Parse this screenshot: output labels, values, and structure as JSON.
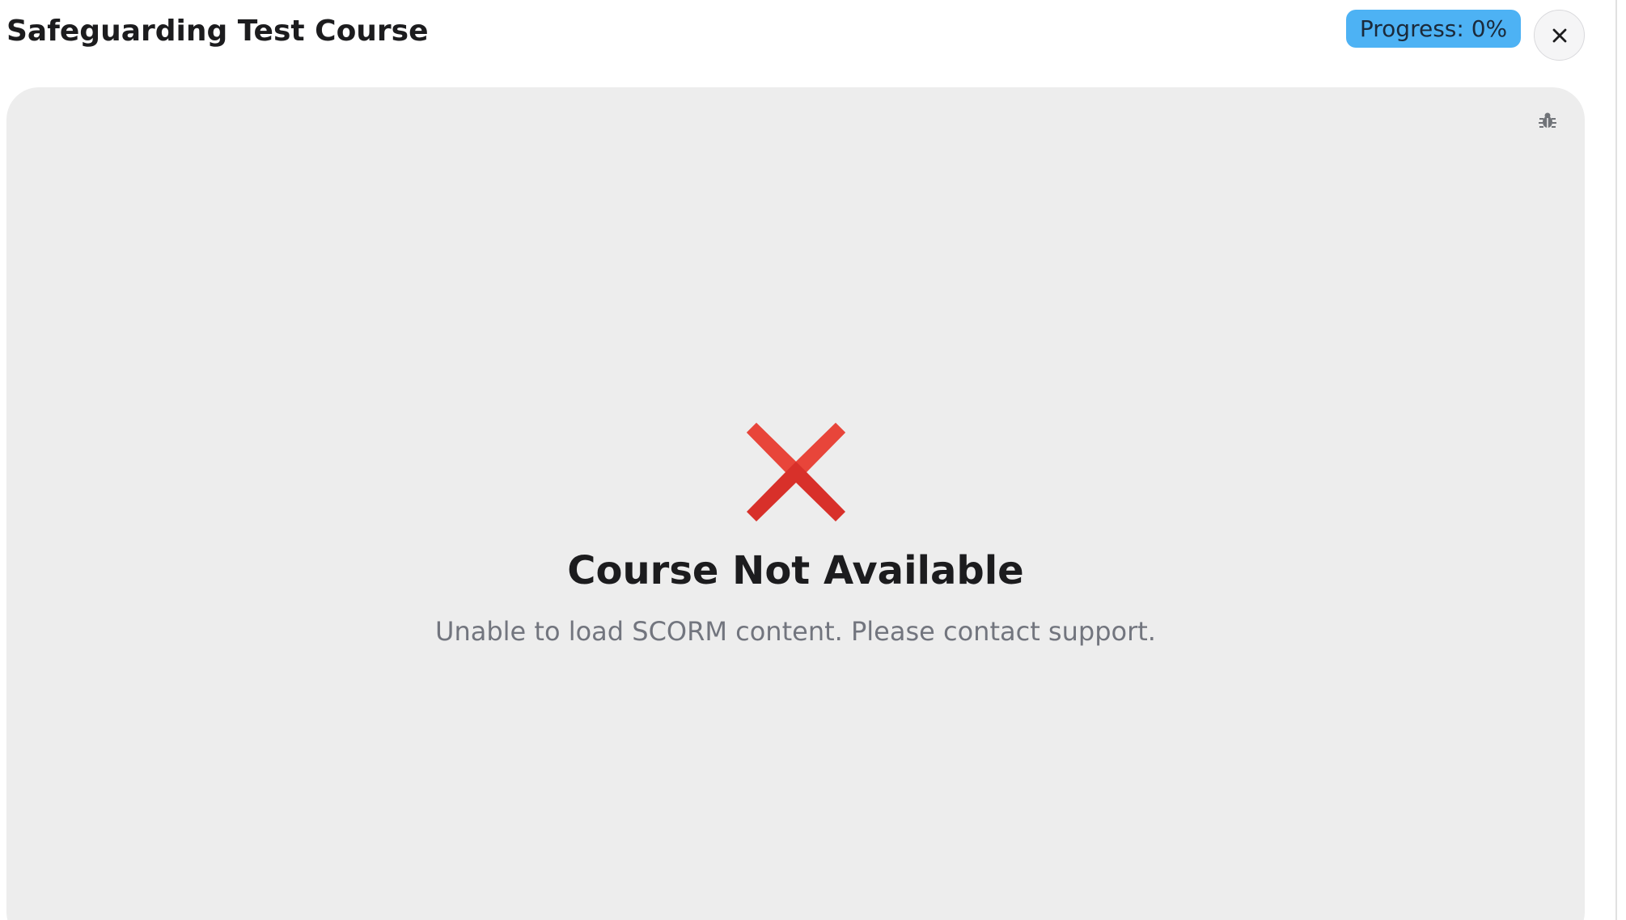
{
  "header": {
    "title": "Safeguarding Test Course",
    "progress_label": "Progress: 0%",
    "progress_value": 0,
    "close_label": "×"
  },
  "viewer": {
    "debug_icon": "bug-icon",
    "error": {
      "icon": "red-x-icon",
      "title": "Course Not Available",
      "message": "Unable to load SCORM content. Please contact support."
    }
  },
  "colors": {
    "progress_badge": "#4db2f4",
    "viewer_background": "#ededed",
    "error_red": "#d8302a",
    "title_text": "#1c1c1e",
    "muted_text": "#72757e"
  }
}
